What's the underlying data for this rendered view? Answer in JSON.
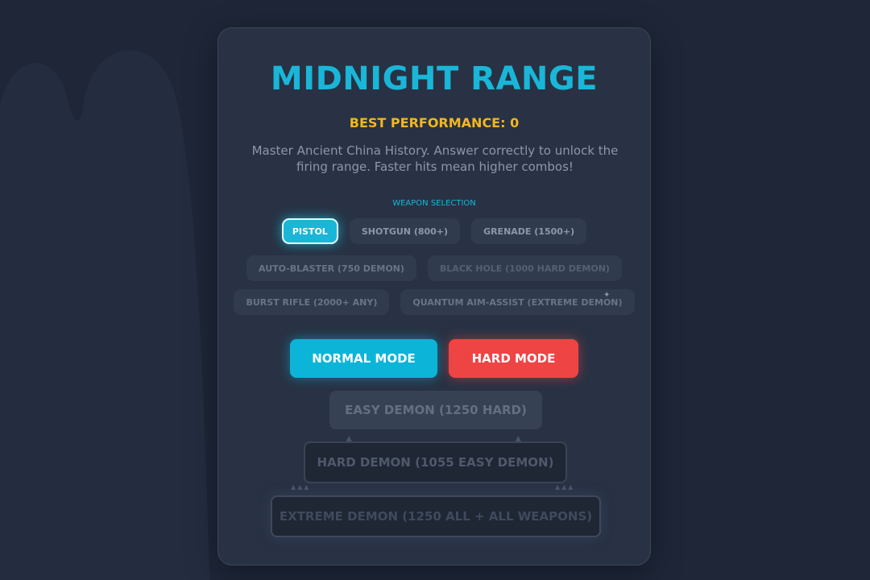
{
  "game": {
    "title": "MIDNIGHT RANGE",
    "best_performance": "BEST PERFORMANCE: 0",
    "description": "Master Ancient China History. Answer correctly to unlock the firing range. Faster hits mean higher combos!"
  },
  "weapons": {
    "title": "WEAPON SELECTION",
    "row1": [
      {
        "label": "PISTOL",
        "state": "selected"
      },
      {
        "label": "SHOTGUN (800+)",
        "state": "locked"
      },
      {
        "label": "GRENADE (1500+)",
        "state": "locked"
      }
    ],
    "row2": [
      {
        "label": "AUTO-BLASTER (750 DEMON)",
        "state": "locked"
      },
      {
        "label": "BLACK HOLE (1000 HARD DEMON)",
        "state": "locked"
      }
    ],
    "row3": [
      {
        "label": "BURST RIFLE (2000+ ANY)",
        "state": "locked"
      },
      {
        "label": "QUANTUM AIM-ASSIST (EXTREME DEMON)",
        "state": "locked"
      }
    ]
  },
  "modes": {
    "normal": "NORMAL MODE",
    "hard": "HARD MODE",
    "easy_demon": "EASY DEMON (1250 HARD)",
    "hard_demon": "HARD DEMON (1055 EASY DEMON)",
    "extreme_demon": "EXTREME DEMON (1250 ALL + ALL WEAPONS)"
  },
  "colors": {
    "accent": "#19b6d8",
    "gold": "#f3b61f",
    "hard": "#ef4444",
    "background": "#1e2638",
    "card": "#283244"
  }
}
